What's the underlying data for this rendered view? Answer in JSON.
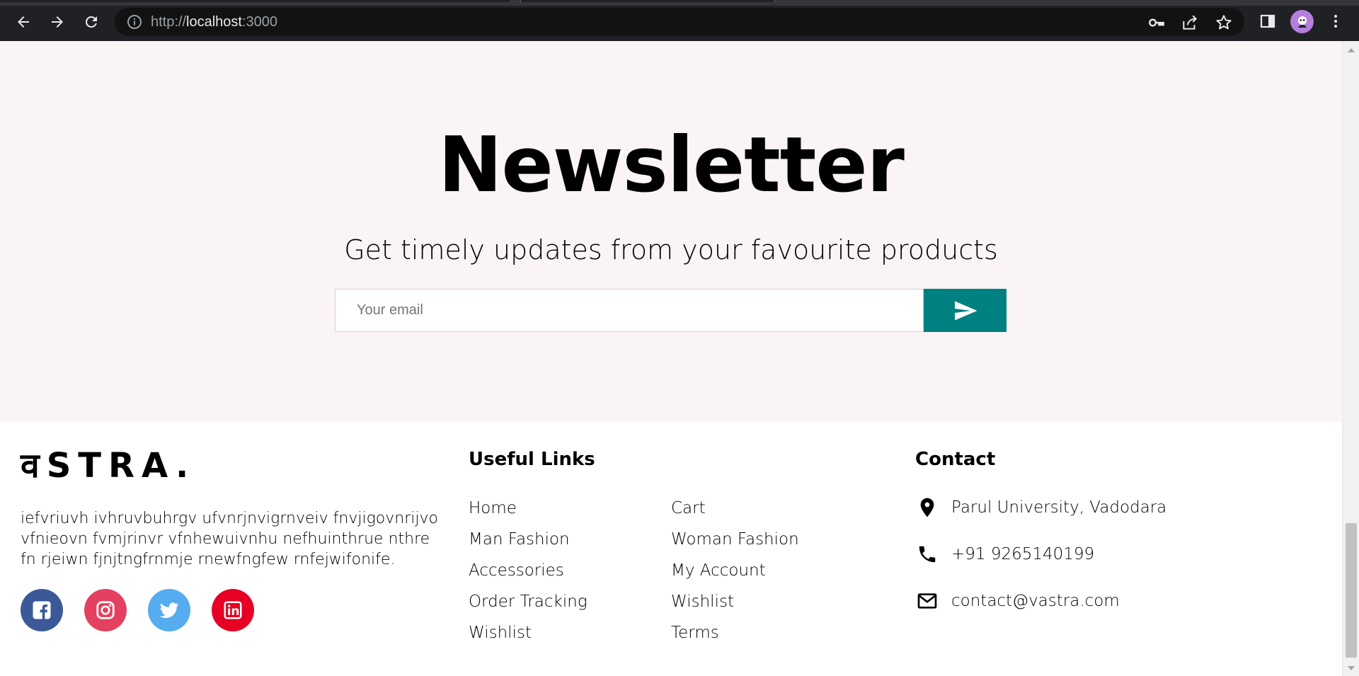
{
  "browser": {
    "url_scheme": "http://",
    "url_host": "localhost",
    "url_port": ":3000"
  },
  "newsletter": {
    "title": "Newsletter",
    "subtitle": "Get timely updates from your favourite products",
    "email_placeholder": "Your email",
    "accent_color": "#008080",
    "background_color": "#fbf4f4"
  },
  "footer": {
    "brand": {
      "logo_text": "वSTRA.",
      "description": "iefvriuvh ivhruvbuhrgv ufvnrjnvigrnveiv fnvjigovnrijvo vfnieovn fvmjrinvr vfnhewuivnhu nefhuinthrue nthre fn rjeiwn fjnjtngfrnmje rnewfngfew rnfejwifonife."
    },
    "social": [
      {
        "name": "facebook",
        "icon": "facebook-icon",
        "color": "#3b5998"
      },
      {
        "name": "instagram",
        "icon": "instagram-icon",
        "color": "#e4405f"
      },
      {
        "name": "twitter",
        "icon": "twitter-icon",
        "color": "#55acee"
      },
      {
        "name": "linkedin",
        "icon": "linkedin-icon",
        "color": "#e60023"
      }
    ],
    "useful_links": {
      "title": "Useful Links",
      "col1": [
        "Home",
        "Man Fashion",
        "Accessories",
        "Order Tracking",
        "Wishlist"
      ],
      "col2": [
        "Cart",
        "Woman Fashion",
        "My Account",
        "Wishlist",
        "Terms"
      ]
    },
    "contact": {
      "title": "Contact",
      "address": "Parul University, Vadodara",
      "phone": "+91 9265140199",
      "email": "contact@vastra.com"
    }
  }
}
